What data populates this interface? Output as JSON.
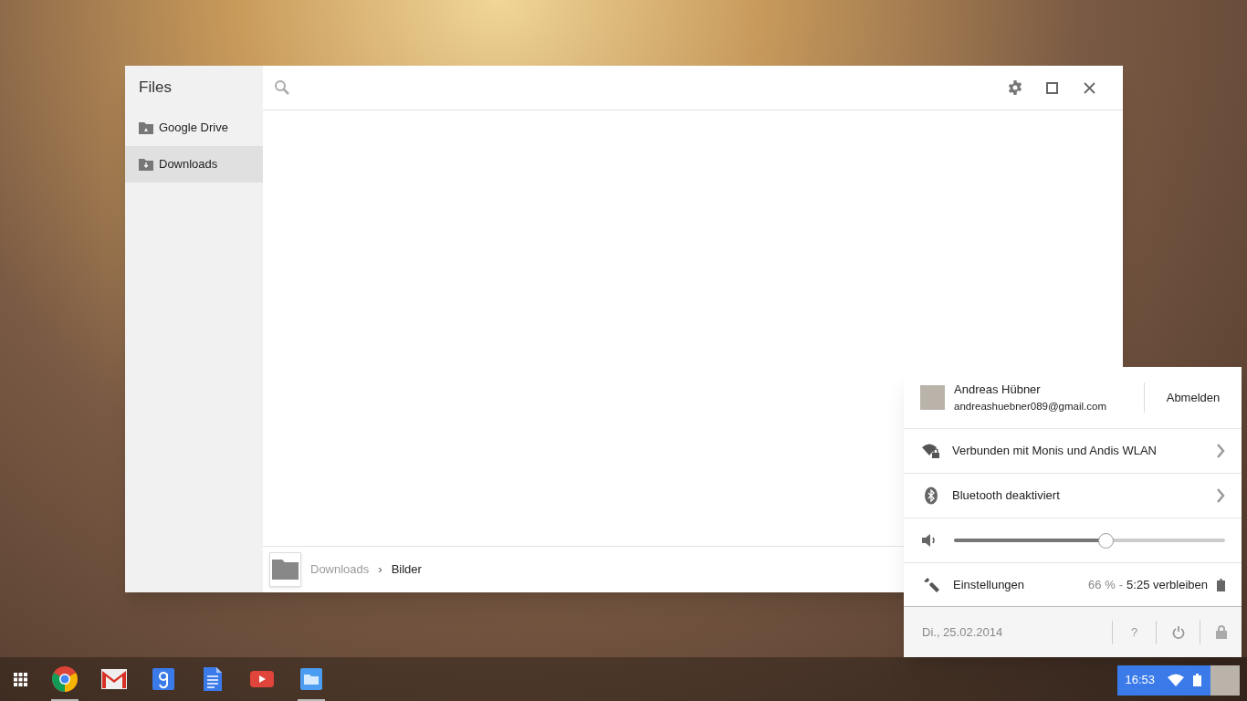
{
  "files_window": {
    "title": "Files",
    "sidebar": {
      "items": [
        {
          "label": "Google Drive",
          "kind": "drive",
          "selected": false
        },
        {
          "label": "Downloads",
          "kind": "downloads",
          "selected": true
        }
      ]
    },
    "breadcrumb": [
      {
        "label": "Downloads",
        "current": false
      },
      {
        "label": "Bilder",
        "current": true
      }
    ],
    "separator": "›"
  },
  "tray_menu": {
    "user": {
      "name": "Andreas Hübner",
      "email": "andreashuebner089@gmail.com"
    },
    "sign_out": "Abmelden",
    "rows": [
      {
        "kind": "network",
        "label": "Verbunden mit Monis und Andis WLAN"
      },
      {
        "kind": "bluetooth",
        "label": "Bluetooth deaktiviert"
      }
    ],
    "volume": {
      "level": 0.56
    },
    "settings": "Einstellungen",
    "battery_percent": "66 %",
    "battery_separator": "-",
    "battery_remaining": "5:25 verbleiben",
    "date": "Di., 25.02.2014",
    "help": "?"
  },
  "shelf": {
    "apps": [
      {
        "kind": "chrome",
        "running": true
      },
      {
        "kind": "gmail",
        "running": false
      },
      {
        "kind": "search",
        "running": false
      },
      {
        "kind": "docs",
        "running": false
      },
      {
        "kind": "youtube",
        "running": false
      },
      {
        "kind": "files",
        "running": true
      }
    ],
    "clock": "16:53"
  }
}
